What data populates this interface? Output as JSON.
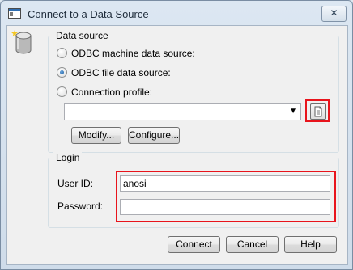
{
  "window": {
    "title": "Connect to a Data Source",
    "close_glyph": "✕"
  },
  "data_source": {
    "group_title": "Data source",
    "options": [
      {
        "label": "ODBC machine data source:",
        "selected": false
      },
      {
        "label": "ODBC file data source:",
        "selected": true
      },
      {
        "label": "Connection profile:",
        "selected": false
      }
    ],
    "profile_value": "",
    "modify_label": "Modify...",
    "configure_label": "Configure..."
  },
  "login": {
    "group_title": "Login",
    "user_id_label": "User ID:",
    "user_id_value": "anosi",
    "password_label": "Password:",
    "password_value": ""
  },
  "buttons": {
    "connect": "Connect",
    "cancel": "Cancel",
    "help": "Help"
  },
  "colors": {
    "highlight": "#e8141c",
    "dialog_bg": "#f0f0f0"
  }
}
